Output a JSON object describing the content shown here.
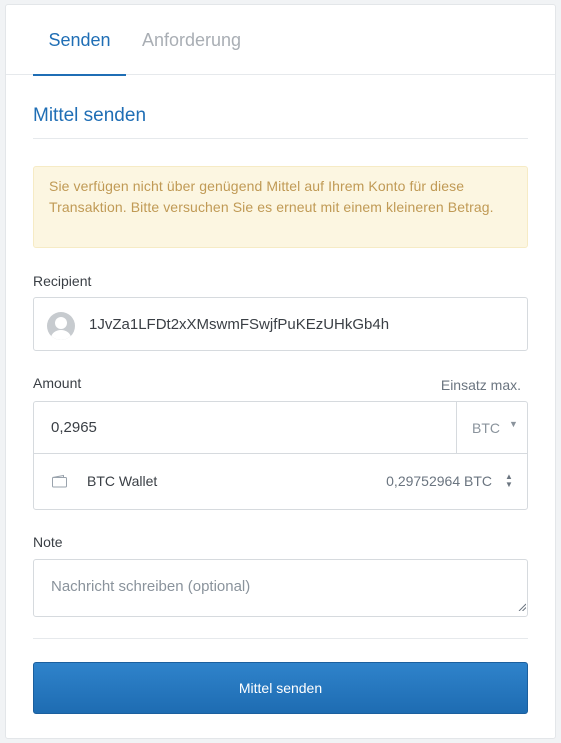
{
  "tabs": [
    {
      "label": "Senden",
      "active": true
    },
    {
      "label": "Anforderung",
      "active": false
    }
  ],
  "section_title": "Mittel senden",
  "warning_text": "Sie verfügen nicht über genügend Mittel auf Ihrem Konto für diese Transaktion. Bitte versuchen Sie es erneut mit einem kleineren Betrag.",
  "recipient": {
    "label": "Recipient",
    "address": "1JvZa1LFDt2xXMswmFSwjfPuKEzUHkGb4h"
  },
  "amount": {
    "label": "Amount",
    "use_max": "Einsatz max.",
    "value": "0,2965",
    "currency": "BTC"
  },
  "wallet": {
    "name": "BTC Wallet",
    "balance": "0,29752964 BTC"
  },
  "note": {
    "label": "Note",
    "placeholder": "Nachricht schreiben (optional)",
    "value": ""
  },
  "submit_label": "Mittel senden",
  "colors": {
    "accent": "#1f6eb5",
    "warning_bg": "#fcf6e1",
    "warning_text": "#c09a55",
    "button": "#2876c0"
  },
  "icons": {
    "avatar": "user-avatar-icon",
    "currency_caret": "caret-down-icon",
    "wallet": "wallet-icon",
    "selector": "up-down-arrows-icon",
    "resize": "resize-grip-icon"
  }
}
